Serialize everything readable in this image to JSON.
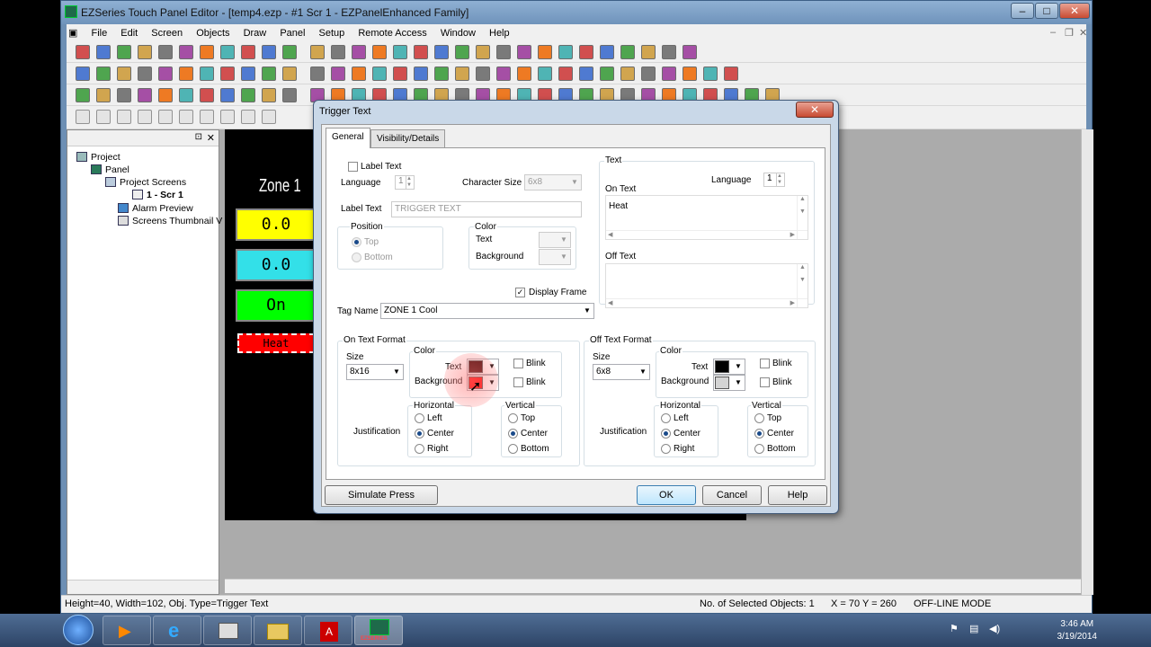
{
  "window": {
    "title": "EZSeries Touch Panel Editor - [temp4.ezp - #1 Scr 1 - EZPanelEnhanced Family]",
    "min": "–",
    "max": "□",
    "close": "✕"
  },
  "menu": [
    "File",
    "Edit",
    "Screen",
    "Objects",
    "Draw",
    "Panel",
    "Setup",
    "Remote Access",
    "Window",
    "Help"
  ],
  "tree": {
    "nodes": [
      {
        "label": "Project"
      },
      {
        "label": "Panel"
      },
      {
        "label": "Project Screens"
      },
      {
        "label": "1 - Scr 1"
      },
      {
        "label": "Alarm Preview"
      },
      {
        "label": "Screens Thumbnail V"
      }
    ],
    "pin": "⊡",
    "close": "✕"
  },
  "screen": {
    "zone_label": "Zone 1",
    "boxes": [
      {
        "text": "0.0",
        "color": "#ffff00"
      },
      {
        "text": "0.0",
        "color": "#33e0e8"
      },
      {
        "text": "On",
        "color": "#00ff00"
      },
      {
        "text": "Heat",
        "color": "#ff0000"
      }
    ]
  },
  "dialog": {
    "title": "Trigger Text",
    "close": "✕",
    "tabs": [
      "General",
      "Visibility/Details"
    ],
    "label_text_check": "Label Text",
    "language_label": "Language",
    "language_value": "1",
    "char_size_label": "Character Size",
    "char_size_value": "6x8",
    "label_text_label": "Label Text",
    "label_text_value": "TRIGGER TEXT",
    "position_label": "Position",
    "pos_top": "Top",
    "pos_bottom": "Bottom",
    "color_label": "Color",
    "color_text": "Text",
    "color_background": "Background",
    "display_frame": "Display Frame",
    "tag_name_label": "Tag Name",
    "tag_name_value": "ZONE 1 Cool",
    "text_section": "Text",
    "text_language_label": "Language",
    "text_language_value": "1",
    "on_text_label": "On Text",
    "on_text_value": "Heat",
    "off_text_label": "Off Text",
    "off_text_value": "",
    "on_format": {
      "title": "On Text Format",
      "size_label": "Size",
      "size_value": "8x16",
      "color_label": "Color",
      "text_label": "Text",
      "bg_label": "Background",
      "text_color": "#3a0000",
      "bg_color": "#ff0000",
      "blink": "Blink",
      "just_label": "Justification",
      "horiz_label": "Horizontal",
      "vert_label": "Vertical",
      "left": "Left",
      "center": "Center",
      "right": "Right",
      "top": "Top",
      "vcenter": "Center",
      "bottom": "Bottom"
    },
    "off_format": {
      "title": "Off Text Format",
      "size_label": "Size",
      "size_value": "6x8",
      "color_label": "Color",
      "text_label": "Text",
      "bg_label": "Background",
      "text_color": "#000000",
      "bg_color": "#d4d4d4",
      "blink": "Blink",
      "just_label": "Justification",
      "horiz_label": "Horizontal",
      "vert_label": "Vertical",
      "left": "Left",
      "center": "Center",
      "right": "Right",
      "top": "Top",
      "vcenter": "Center",
      "bottom": "Bottom"
    },
    "simulate": "Simulate Press",
    "ok": "OK",
    "cancel": "Cancel",
    "help": "Help"
  },
  "status": {
    "info": "Height=40, Width=102, Obj. Type=Trigger Text",
    "selected": "No. of Selected Objects: 1",
    "coords": "X = 70  Y = 260",
    "mode": "OFF-LINE MODE"
  },
  "clock": {
    "time": "3:46 AM",
    "date": "3/19/2014"
  },
  "taskbar_apps": [
    "windows-explorer",
    "media-player",
    "internet-explorer",
    "app-window",
    "file-explorer",
    "pdf-reader",
    "ezseries"
  ],
  "ezseries_badge": "EZSERIES"
}
